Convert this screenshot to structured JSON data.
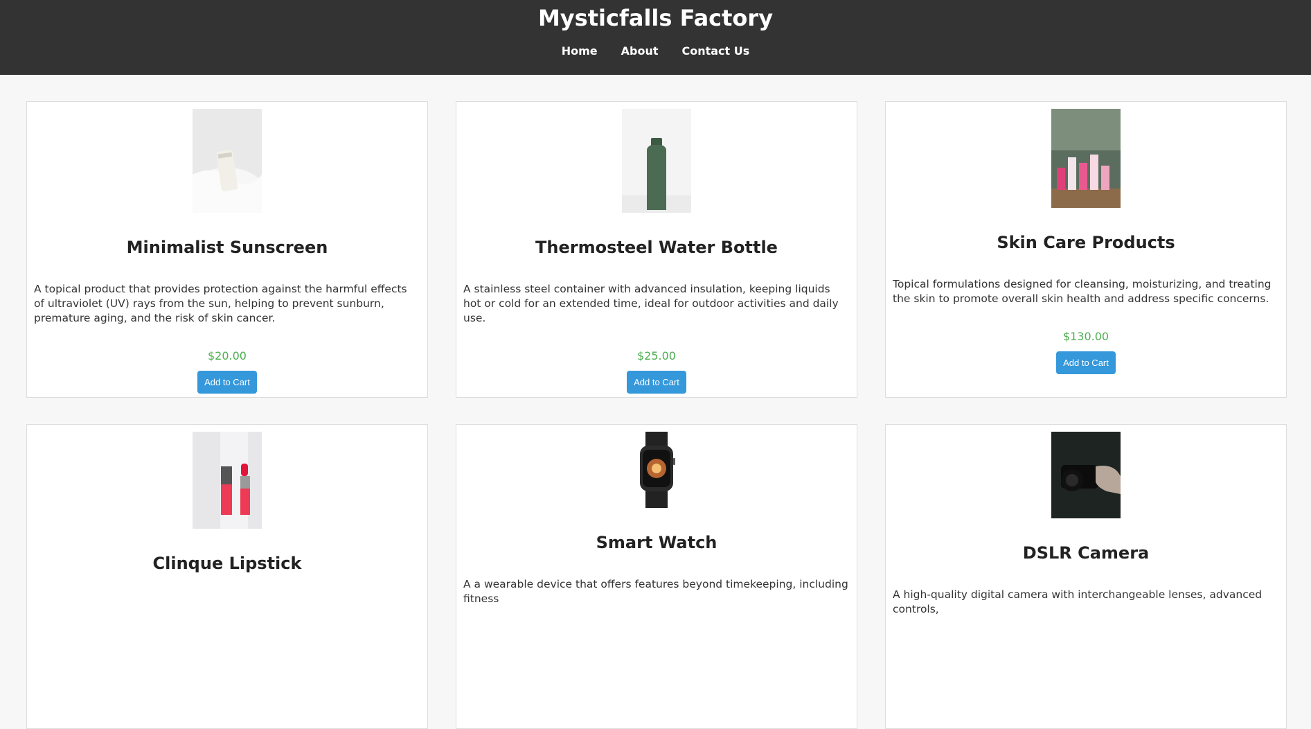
{
  "site": {
    "title": "Mysticfalls Factory"
  },
  "nav": {
    "items": [
      {
        "label": "Home"
      },
      {
        "label": "About"
      },
      {
        "label": "Contact Us"
      }
    ]
  },
  "products": [
    {
      "name": "Minimalist Sunscreen",
      "description": "A topical product that provides protection against the harmful effects of ultraviolet (UV) rays from the sun, helping to prevent sunburn, premature aging, and the risk of skin cancer.",
      "price": "$20.00",
      "button": "Add to Cart",
      "image": "sunscreen-tube"
    },
    {
      "name": "Thermosteel Water Bottle",
      "description": "A stainless steel container with advanced insulation, keeping liquids hot or cold for an extended time, ideal for outdoor activities and daily use.",
      "price": "$25.00",
      "button": "Add to Cart",
      "image": "green-bottle"
    },
    {
      "name": "Skin Care Products",
      "description": "Topical formulations designed for cleansing, moisturizing, and treating the skin to promote overall skin health and address specific concerns.",
      "price": "$130.00",
      "button": "Add to Cart",
      "image": "pink-skincare-set"
    },
    {
      "name": "Clinque Lipstick",
      "description": "",
      "price": "",
      "button": "",
      "image": "red-lipstick"
    },
    {
      "name": "Smart Watch",
      "description": "A a wearable device that offers features beyond timekeeping, including fitness",
      "price": "",
      "button": "",
      "image": "smart-watch"
    },
    {
      "name": "DSLR Camera",
      "description": "A high-quality digital camera with interchangeable lenses, advanced controls,",
      "price": "",
      "button": "",
      "image": "camera-in-hand"
    }
  ]
}
